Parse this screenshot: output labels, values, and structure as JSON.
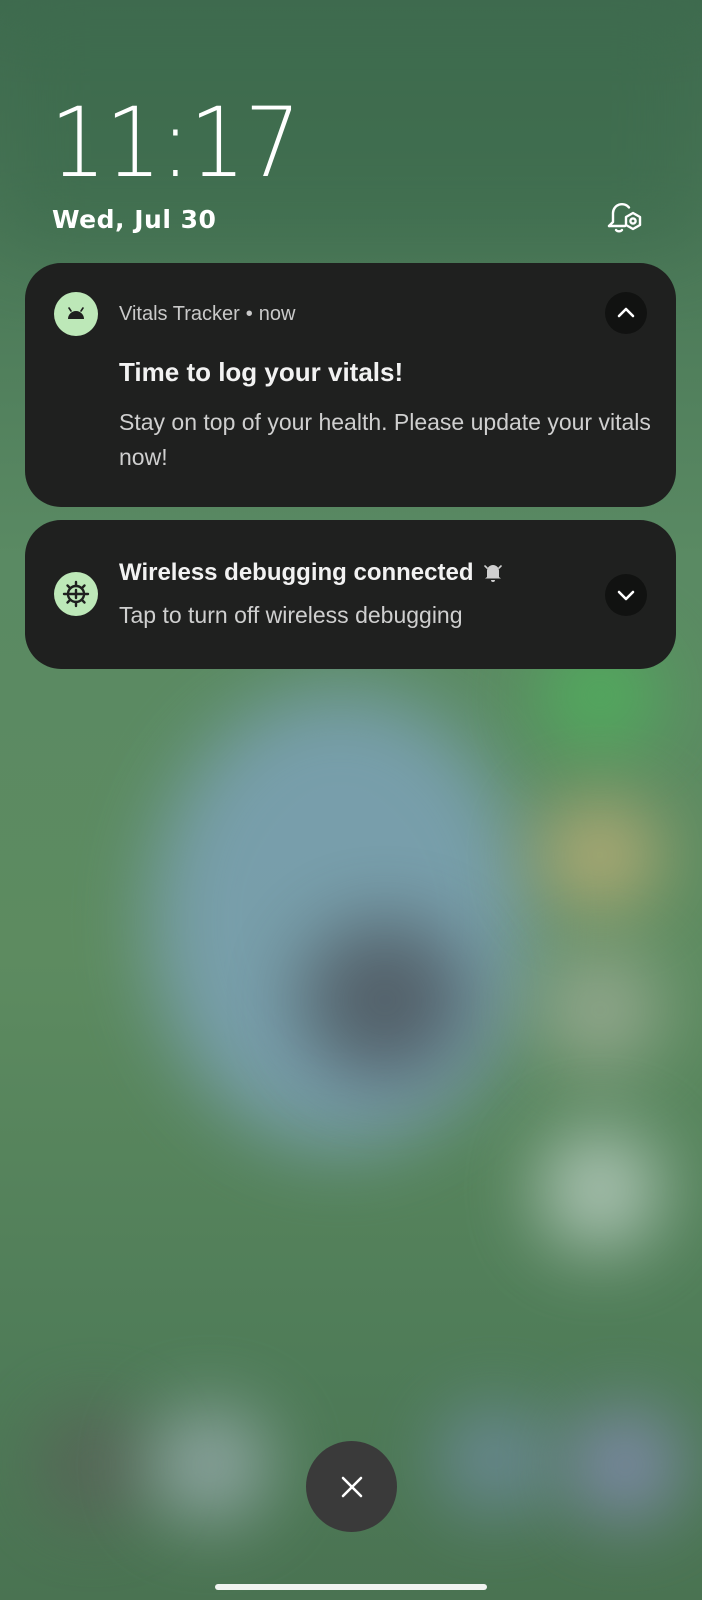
{
  "lockscreen": {
    "time": "11:17",
    "date": "Wed, Jul 30",
    "notification_settings_icon": "bell-settings-icon"
  },
  "notifications": [
    {
      "app_name": "Vitals Tracker",
      "separator": "•",
      "time": "now",
      "title": "Time to log your vitals!",
      "body": "Stay on top of your health. Please update your vitals now!",
      "icon": "android-head-icon",
      "expand_icon": "chevron-up-icon"
    },
    {
      "title": "Wireless debugging connected",
      "body": "Tap to turn off wireless debugging",
      "icon": "debug-gear-icon",
      "alert_icon": "bell-alert-icon",
      "expand_icon": "chevron-down-icon"
    }
  ],
  "controls": {
    "dismiss_icon": "close-icon"
  },
  "colors": {
    "card_background": "#1f201f",
    "icon_accent": "#bde8b8",
    "wallpaper": "#4f7a5b"
  }
}
